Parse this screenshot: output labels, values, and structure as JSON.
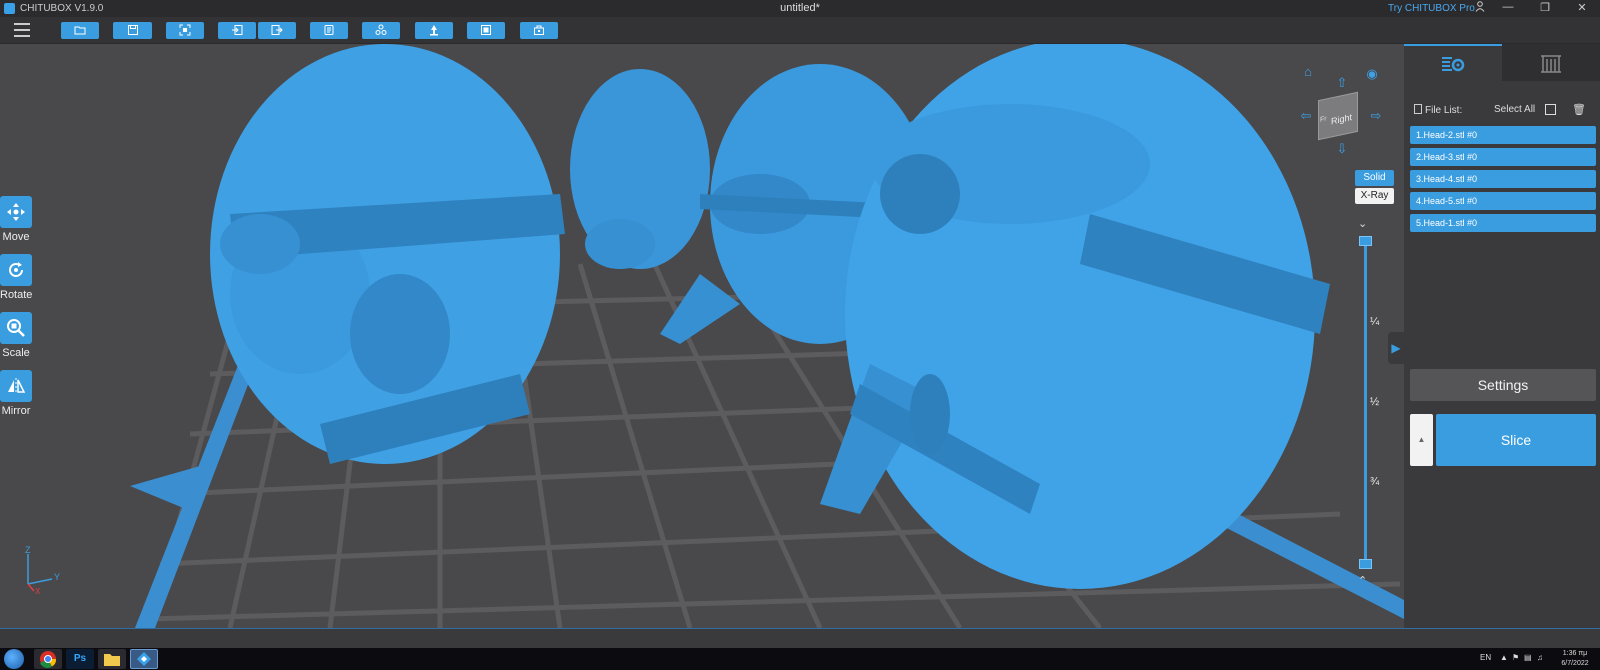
{
  "titlebar": {
    "app_title": "CHITUBOX V1.9.0",
    "doc_title": "untitled*",
    "try_pro": "Try CHITUBOX Pro",
    "icons": [
      "user-icon",
      "minimize-icon",
      "restore-icon",
      "close-icon"
    ]
  },
  "toolbar": {
    "icons": [
      "menu-icon",
      "open-folder-icon",
      "save-icon",
      "screenshot-icon",
      "import-icon",
      "export-icon",
      "copy-icon",
      "layout-icon",
      "support-icon",
      "hollow-icon",
      "build-plate-icon"
    ]
  },
  "left_tools": [
    {
      "label": "Move",
      "icon": "move-icon"
    },
    {
      "label": "Rotate",
      "icon": "rotate-icon"
    },
    {
      "label": "Scale",
      "icon": "scale-icon"
    },
    {
      "label": "Mirror",
      "icon": "mirror-icon"
    }
  ],
  "view": {
    "cube_face": "Right",
    "cube_side": "Fr",
    "modes": {
      "solid": "Solid",
      "xray": "X-Ray"
    },
    "fractions": [
      "¼",
      "½",
      "¾"
    ],
    "axes": {
      "z": "Z",
      "y": "Y",
      "x": "X"
    }
  },
  "right_panel": {
    "file_list_label": "File List:",
    "select_all": "Select All",
    "files": [
      "1.Head-2.stl #0",
      "2.Head-3.stl #0",
      "3.Head-4.stl #0",
      "4.Head-5.stl #0",
      "5.Head-1.stl #0"
    ],
    "settings": "Settings",
    "slice": "Slice"
  },
  "taskbar": {
    "apps": [
      "windows-start-icon",
      "chrome-icon",
      "photoshop-icon",
      "file-explorer-icon",
      "chitubox-icon"
    ],
    "ps_label": "Ps",
    "lang": "EN",
    "time": "1:36 πμ",
    "date": "6/7/2022"
  },
  "colors": {
    "accent": "#3a9de0",
    "model": "#3f9fe2",
    "background": "#49494b",
    "grid": "#5e5e60"
  }
}
